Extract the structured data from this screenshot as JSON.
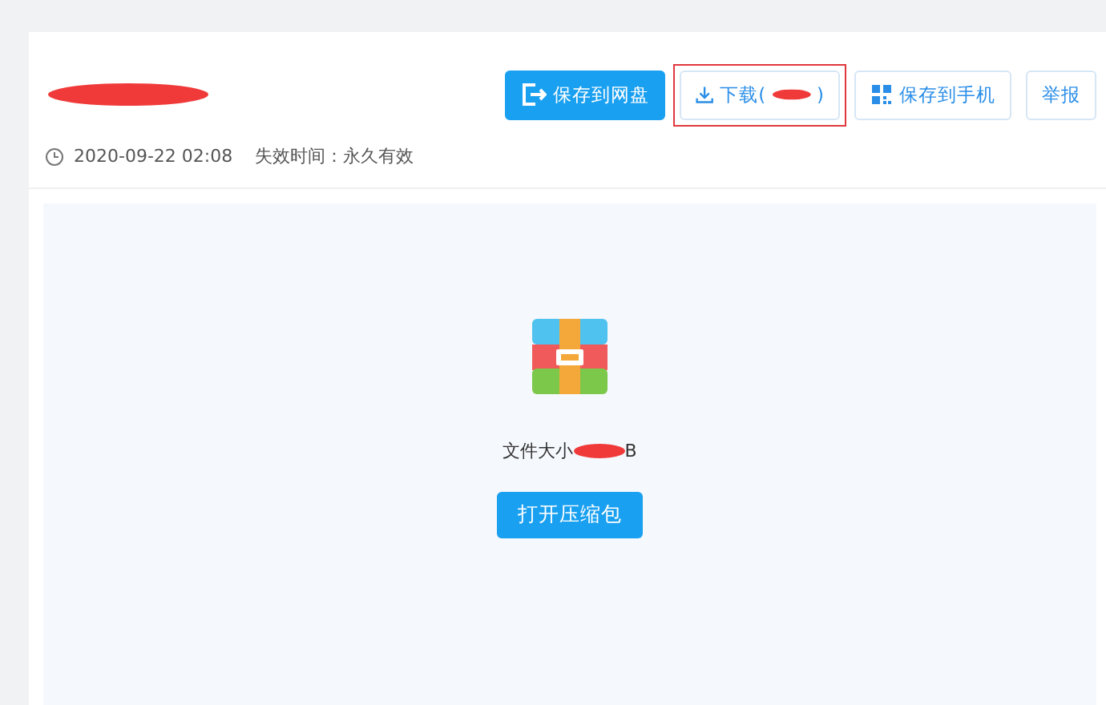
{
  "header": {
    "buttons": [
      {
        "kind": "primary",
        "label": "保存到网盘"
      },
      {
        "kind": "download",
        "label": "下载(",
        "suffix": ")",
        "highlighted": true
      },
      {
        "kind": "phone",
        "label": "保存到手机"
      },
      {
        "kind": "outline",
        "label": "举报"
      }
    ]
  },
  "meta": {
    "date": "2020-09-22 02:08",
    "expiry": "失效时间：永久有效"
  },
  "preview": {
    "size_label": "文件大小",
    "size_suffix": "B",
    "open_button": "打开压缩包"
  }
}
